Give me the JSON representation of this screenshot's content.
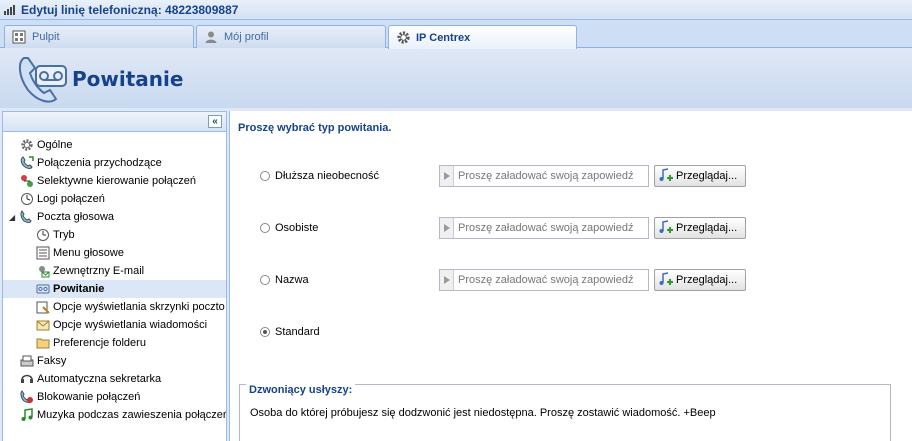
{
  "window": {
    "title": "Edytuj linię telefoniczną: 48223809887"
  },
  "tabs": [
    {
      "label": "Pulpit",
      "icon": "dashboard-icon"
    },
    {
      "label": "Mój profil",
      "icon": "user-icon"
    },
    {
      "label": "IP Centrex",
      "icon": "gear-icon"
    }
  ],
  "header": {
    "title": "Powitanie",
    "icon": "voicemail-phone-icon"
  },
  "sidebar": {
    "collapse_label": "«",
    "items": [
      {
        "label": "Ogólne"
      },
      {
        "label": "Połączenia przychodzące"
      },
      {
        "label": "Selektywne kierowanie połączeń"
      },
      {
        "label": "Logi połączeń"
      },
      {
        "label": "Poczta głosowa"
      },
      {
        "label": "Tryb"
      },
      {
        "label": "Menu głosowe"
      },
      {
        "label": "Zewnętrzny E-mail"
      },
      {
        "label": "Powitanie"
      },
      {
        "label": "Opcje wyświetlania skrzynki poczto"
      },
      {
        "label": "Opcje wyświetlania wiadomości"
      },
      {
        "label": "Preferencje folderu"
      },
      {
        "label": "Faksy"
      },
      {
        "label": "Automatyczna sekretarka"
      },
      {
        "label": "Blokowanie połączeń"
      },
      {
        "label": "Muzyka podczas zawieszenia połączeń"
      }
    ]
  },
  "main": {
    "prompt": "Proszę wybrać typ powitania.",
    "options": [
      {
        "label": "Dłuższa nieobecność",
        "placeholder": "Proszę załadować swoją zapowiedź",
        "browse": "Przeglądaj..."
      },
      {
        "label": "Osobiste",
        "placeholder": "Proszę załadować swoją zapowiedź",
        "browse": "Przeglądaj..."
      },
      {
        "label": "Nazwa",
        "placeholder": "Proszę załadować swoją zapowiedź",
        "browse": "Przeglądaj..."
      },
      {
        "label": "Standard"
      }
    ],
    "selected_option": "Standard",
    "caller_hears": {
      "legend": "Dzwoniący usłyszy:",
      "text": "Osoba do której próbujesz się dodzwonić jest niedostępna. Proszę zostawić wiadomość. +Beep"
    }
  },
  "colors": {
    "accent": "#15428b",
    "border": "#99bbe8",
    "selected_bg": "#dbe6f6"
  }
}
